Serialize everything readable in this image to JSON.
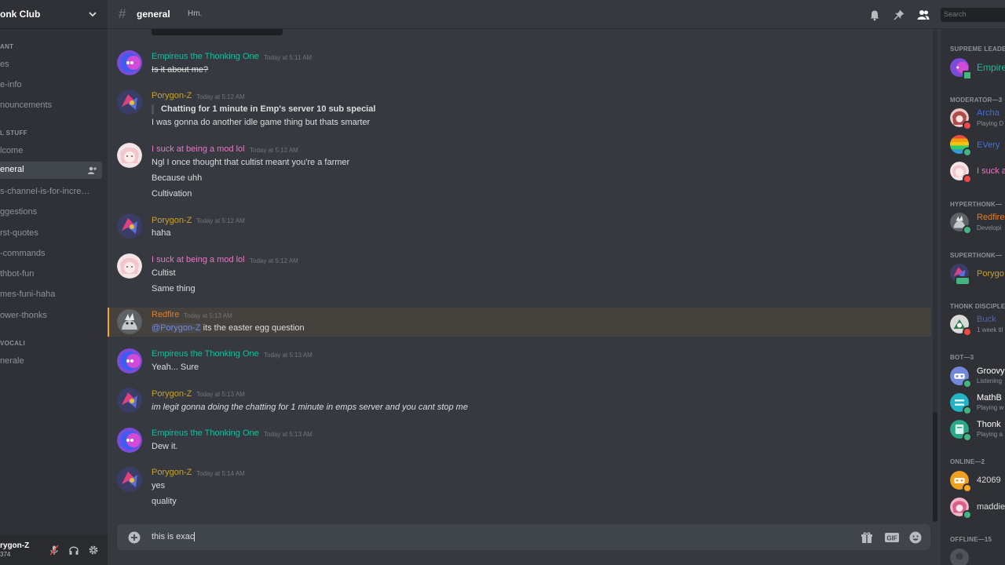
{
  "server": {
    "name": "onk Club"
  },
  "sidebar": {
    "categories": [
      "ANT",
      "L STUFF",
      "VOCALI"
    ],
    "channels": [
      "es",
      "e-info",
      "nouncements",
      "lcome",
      "ggestions",
      "rst-quotes",
      "-commands",
      "thbot-fun",
      "mes-funi-haha",
      "ower-thonks",
      "nerale"
    ],
    "s_channel": "s-channel-is-for-incre…",
    "active_channel": "eneral"
  },
  "user_panel": {
    "name": "rygon-Z",
    "tag": "374"
  },
  "topbar": {
    "channel": "general",
    "topic": "Hm.",
    "search_placeholder": "Search",
    "hash": "#"
  },
  "messages": [
    {
      "author": "Empireus the Thonking One",
      "color": "#1abc9c",
      "time": "Today at 5:11 AM",
      "lines": [
        "Is it about me?"
      ]
    },
    {
      "author": "Porygon-Z",
      "color": "#c9a227",
      "time": "Today at 5:12 AM",
      "quote": "Chatting for 1 minute in Emp's server 10 sub special",
      "lines": [
        "I was gonna do another idle game thing but thats smarter"
      ]
    },
    {
      "author": "I suck at being a mod lol",
      "color": "#e07bc1",
      "time": "Today at 5:12 AM",
      "lines": [
        "Ngl I once thought that cultist meant you're a farmer",
        "Because uhh",
        "Cultivation"
      ]
    },
    {
      "author": "Porygon-Z",
      "color": "#c9a227",
      "time": "Today at 5:12 AM",
      "lines": [
        "haha"
      ]
    },
    {
      "author": "I suck at being a mod lol",
      "color": "#e07bc1",
      "time": "Today at 5:12 AM",
      "lines": [
        "Cultist",
        "Same thing"
      ]
    },
    {
      "author": "Redfire",
      "color": "#e67e22",
      "time": "Today at 5:13 AM",
      "mention": "@Porygon-Z",
      "lines": [
        " its the easter egg question"
      ]
    },
    {
      "author": "Empireus the Thonking One",
      "color": "#1abc9c",
      "time": "Today at 5:13 AM",
      "lines": [
        "Yeah... Sure"
      ]
    },
    {
      "author": "Porygon-Z",
      "color": "#c9a227",
      "time": "Today at 5:13 AM",
      "lines": [
        "im legit gonna doing the chatting for 1 minute in emps server and you cant stop me"
      ]
    },
    {
      "author": "Empireus the Thonking One",
      "color": "#1abc9c",
      "time": "Today at 5:13 AM",
      "lines": [
        "Dew it."
      ]
    },
    {
      "author": "Porygon-Z",
      "color": "#c9a227",
      "time": "Today at 5:14 AM",
      "lines": [
        "yes",
        "quality"
      ]
    }
  ],
  "composer": {
    "text": "this is exac"
  },
  "members": {
    "roles": [
      "SUPREME LEADE",
      "MODERATOR—3",
      "HYPERTHONK—",
      "SUPERTHONK—",
      "THONK DISCIPLE",
      "BOT—3",
      "ONLINE—2",
      "OFFLINE—15"
    ],
    "list": [
      {
        "name": "Empire",
        "activity": "",
        "color": "#1abc9c"
      },
      {
        "name": "Archa",
        "activity": "Playing D",
        "color": "#3e70dd"
      },
      {
        "name": "EVery",
        "activity": "",
        "color": "#3e70dd"
      },
      {
        "name": "I suck a",
        "activity": "",
        "color": "#e07bc1"
      },
      {
        "name": "Redfire",
        "activity": "Developi",
        "color": "#e67e22"
      },
      {
        "name": "Porygo",
        "activity": "",
        "color": "#c9a227"
      },
      {
        "name": "Buck",
        "activity": "1 week til",
        "color": "#5865a0"
      },
      {
        "name": "Groovy",
        "activity": "Listening",
        "color": "#ffffff"
      },
      {
        "name": "MathB",
        "activity": "Playing w",
        "color": "#ffffff"
      },
      {
        "name": "Thonk",
        "activity": "Playing a",
        "color": "#ffffff"
      },
      {
        "name": "42069",
        "activity": "",
        "color": "#dcddde"
      },
      {
        "name": "maddie",
        "activity": "",
        "color": "#dcddde"
      },
      {
        "name": "",
        "activity": "",
        "color": "#8e9297"
      }
    ]
  },
  "colors": {
    "online": "#43b581",
    "dnd": "#f04747",
    "idle": "#faa61a"
  }
}
